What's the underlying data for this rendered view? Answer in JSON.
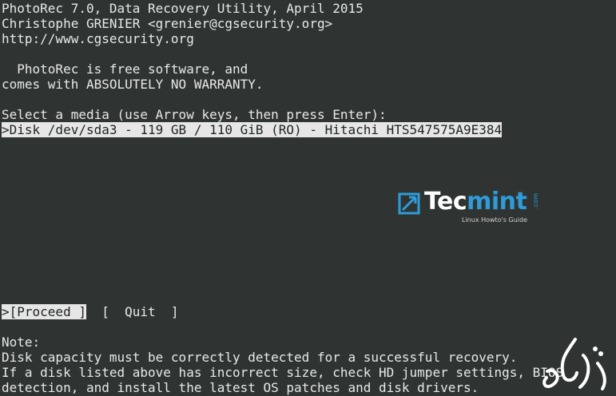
{
  "header": {
    "line1": "PhotoRec 7.0, Data Recovery Utility, April 2015",
    "line2": "Christophe GRENIER <grenier@cgsecurity.org>",
    "line3": "http://www.cgsecurity.org"
  },
  "license": {
    "line1": "  PhotoRec is free software, and",
    "line2": "comes with ABSOLUTELY NO WARRANTY."
  },
  "media": {
    "prompt": "Select a media (use Arrow keys, then press Enter):",
    "items": [
      {
        "label": ">Disk /dev/sda3 - 119 GB / 110 GiB (RO) - Hitachi HTS547575A9E384",
        "selected": true
      }
    ]
  },
  "menu": {
    "proceed": ">[Proceed ]",
    "quit": "[  Quit  ]"
  },
  "note": {
    "title": "Note:",
    "line1": "Disk capacity must be correctly detected for a successful recovery.",
    "line2": "If a disk listed above has incorrect size, check HD jumper settings, BIOS",
    "line3": "detection, and install the latest OS patches and disk drivers."
  },
  "watermark": {
    "brand_prefix": "Tec",
    "brand_suffix": "mint",
    "domain": ".com",
    "tagline": "Linux Howto's Guide"
  },
  "colors": {
    "background": "#2f3433",
    "text": "#e8e8e8",
    "highlight": "#e6e6e6",
    "accent": "#2f9bd8"
  }
}
